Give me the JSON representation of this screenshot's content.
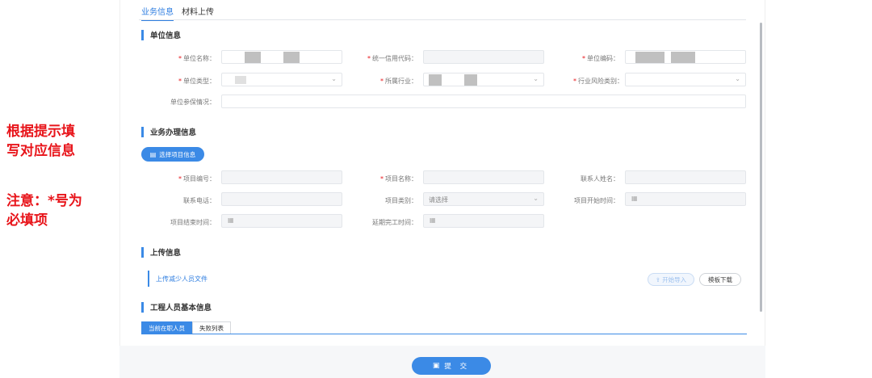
{
  "annotation": {
    "line1": "根据提示填",
    "line2": "写对应信息",
    "line3": "注意：*号为",
    "line4": "必填项"
  },
  "tabs": [
    {
      "label": "业务信息",
      "active": true
    },
    {
      "label": "材料上传",
      "active": false
    }
  ],
  "sections": {
    "unit": "单位信息",
    "business": "业务办理信息",
    "upload": "上传信息",
    "staff": "工程人员基本信息"
  },
  "unit_fields": {
    "name": "单位名称：",
    "credit_code": "统一信用代码：",
    "unit_code": "单位编码：",
    "unit_type": "单位类型：",
    "industry": "所属行业：",
    "risk_category": "行业风险类别：",
    "insurance": "单位参保情况："
  },
  "business_fields": {
    "select_button": "选择项目信息",
    "project_no": "项目编号：",
    "project_name": "项目名称：",
    "contact_name": "联系人姓名：",
    "contact_phone": "联系电话：",
    "project_category": "项目类别：",
    "project_category_placeholder": "请选择",
    "start_time": "项目开始时间：",
    "end_time": "项目结束时间：",
    "extend_time": "延期完工时间："
  },
  "upload": {
    "file_label": "上传减少人员文件",
    "import_button": "开始导入",
    "template_button": "模板下载"
  },
  "staff_tabs": [
    {
      "label": "当前在职人员",
      "active": true
    },
    {
      "label": "失败列表",
      "active": false
    }
  ],
  "submit_label": "提 交",
  "colors": {
    "accent": "#3b8ae6",
    "required": "#e8141a",
    "annotation": "#e8141a"
  },
  "icons": {
    "select": "document-icon",
    "calendar": "calendar-icon",
    "chevron": "chevron-down-icon",
    "submit": "clipboard-icon"
  }
}
